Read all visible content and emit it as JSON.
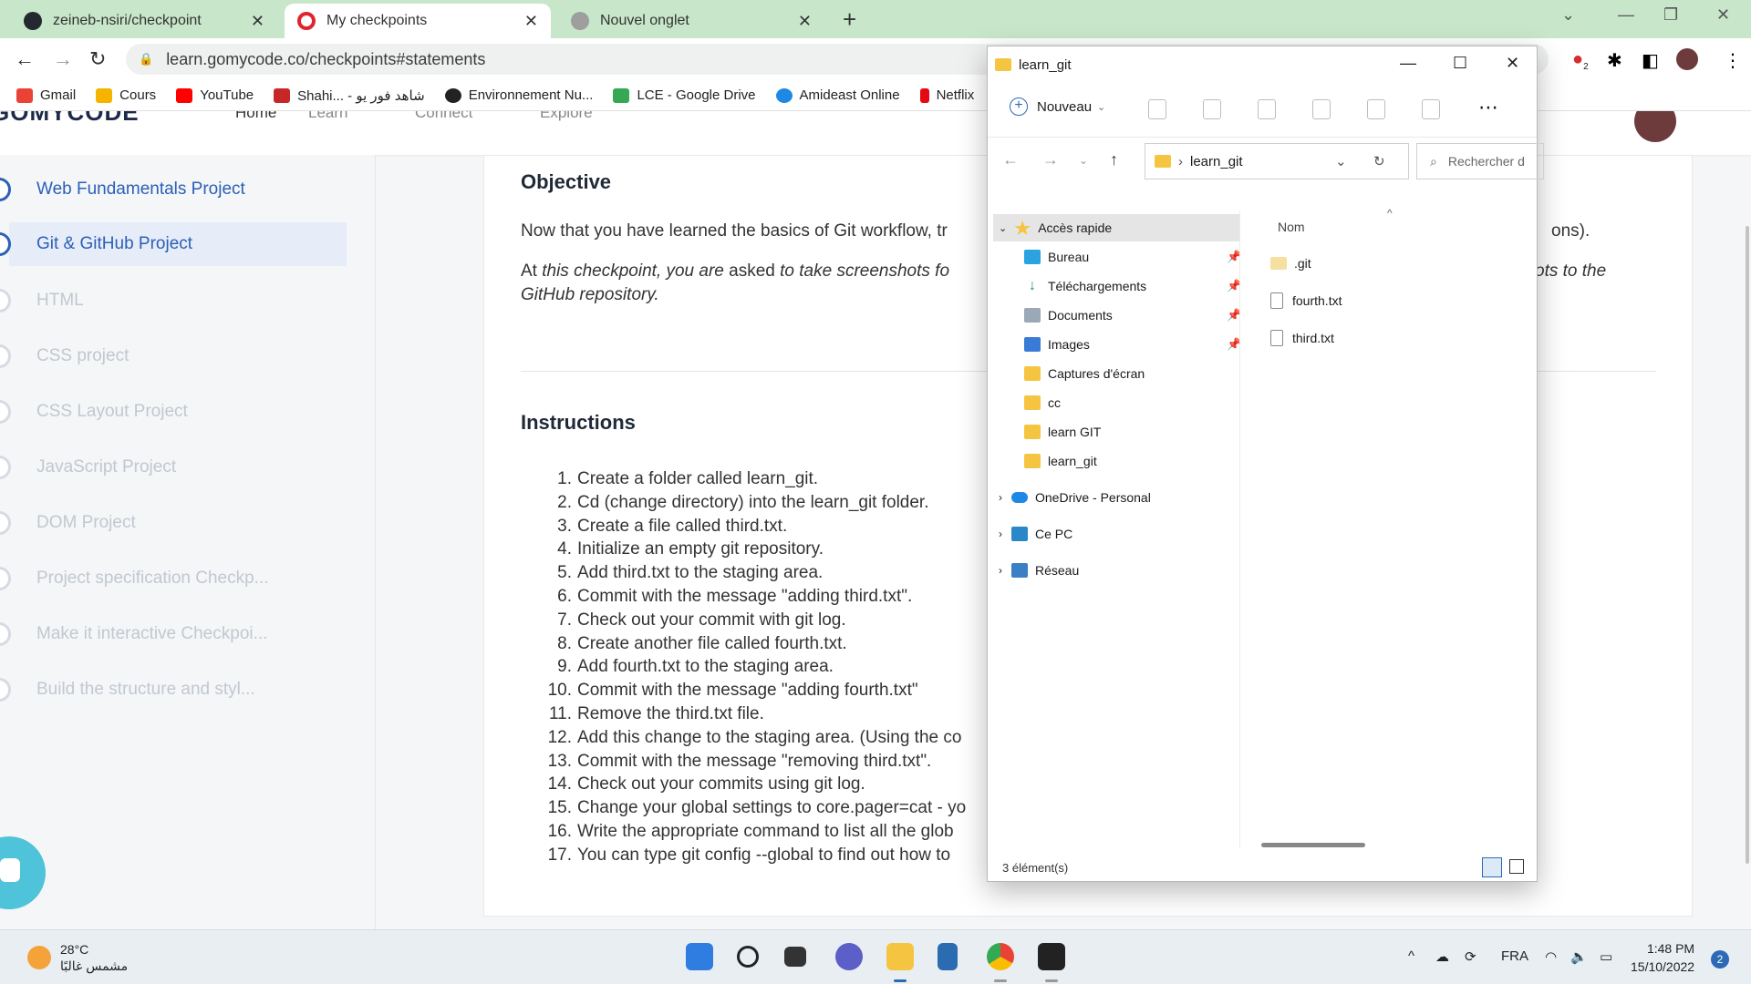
{
  "browser": {
    "tabs": [
      {
        "label": "zeineb-nsiri/checkpoint",
        "active": false
      },
      {
        "label": "My checkpoints",
        "active": true
      },
      {
        "label": "Nouvel onglet",
        "active": false
      }
    ],
    "url": "learn.gomycode.co/checkpoints#statements",
    "bookmarks": [
      "Gmail",
      "Cours",
      "YouTube",
      "Shahi... - شاهد فور يو",
      "Environnement Nu...",
      "LCE - Google Drive",
      "Amideast Online",
      "Netflix"
    ],
    "extension_badge": "2"
  },
  "site": {
    "logo": "GOMYCODE",
    "nav": [
      "Home",
      "Learn",
      "Connect",
      "Explore"
    ],
    "sidebar": [
      {
        "label": "Web Fundamentals Project",
        "state": "done"
      },
      {
        "label": "Git & GitHub Project",
        "state": "current"
      },
      {
        "label": "HTML",
        "state": "pending"
      },
      {
        "label": "CSS project",
        "state": "pending"
      },
      {
        "label": "CSS Layout Project",
        "state": "pending"
      },
      {
        "label": "JavaScript Project",
        "state": "pending"
      },
      {
        "label": "DOM Project",
        "state": "pending"
      },
      {
        "label": "Project specification Checkp...",
        "state": "pending"
      },
      {
        "label": "Make it interactive Checkpoi...",
        "state": "pending"
      },
      {
        "label": "Build the structure and styl...",
        "state": "pending"
      }
    ],
    "objective": {
      "heading": "Objective",
      "p1": "Now that you have learned the basics of Git workflow, tr",
      "p1_end": "ons).",
      "p2_a": "At ",
      "p2_b": "this checkpoint, you are",
      "p2_c": " asked ",
      "p2_d": "to take screenshots fo",
      "p2_end": "ots to the",
      "p2_line2": "GitHub repository."
    },
    "instructions": {
      "heading": "Instructions",
      "steps": [
        "Create a folder called learn_git.",
        "Cd (change directory) into the learn_git folder.",
        "Create a file called third.txt.",
        "Initialize an empty git repository.",
        "Add third.txt to the staging area.",
        "Commit with the message \"adding third.txt\".",
        "Check out your commit with git log.",
        "Create another file called fourth.txt.",
        "Add fourth.txt to the staging area.",
        "Commit with the message \"adding fourth.txt\"",
        "Remove the third.txt file.",
        "Add this change to the staging area. (Using the co",
        "Commit with the message \"removing third.txt\".",
        "Check out your commits using git log.",
        "Change your global settings to core.pager=cat - yo",
        "Write the appropriate command to list all the glob",
        "You can type git config --global to find out how to"
      ]
    }
  },
  "explorer": {
    "title": "learn_git",
    "new_button": "Nouveau",
    "address": "learn_git",
    "search_placeholder": "Rechercher d",
    "tree": {
      "quick_access": "Accès rapide",
      "pinned": [
        "Bureau",
        "Téléchargements",
        "Documents",
        "Images"
      ],
      "folders": [
        "Captures d'écran",
        "cc",
        "learn GIT",
        "learn_git"
      ],
      "roots": [
        "OneDrive - Personal",
        "Ce PC",
        "Réseau"
      ]
    },
    "column_name": "Nom",
    "files": [
      ".git",
      "fourth.txt",
      "third.txt"
    ],
    "status": "3 élément(s)"
  },
  "taskbar": {
    "temperature": "28°C",
    "weather_desc": "مشمس غالبًا",
    "language": "FRA",
    "time": "1:48 PM",
    "date": "15/10/2022",
    "notifications": "2"
  }
}
